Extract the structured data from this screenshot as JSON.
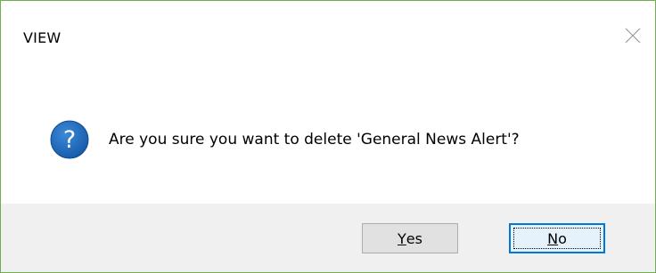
{
  "window": {
    "title": "VIEW",
    "close_icon": "close-icon"
  },
  "body": {
    "icon": "question-icon",
    "icon_color": "#1c64b4",
    "message": "Are you sure you want to delete 'General News Alert'?"
  },
  "buttons": {
    "yes": {
      "mnemonic": "Y",
      "rest": "es"
    },
    "no": {
      "mnemonic": "N",
      "rest": "o"
    }
  },
  "colors": {
    "window_border": "#6fae4b",
    "footer_bg": "#f0f0f0",
    "focus_border": "#0078d7"
  }
}
